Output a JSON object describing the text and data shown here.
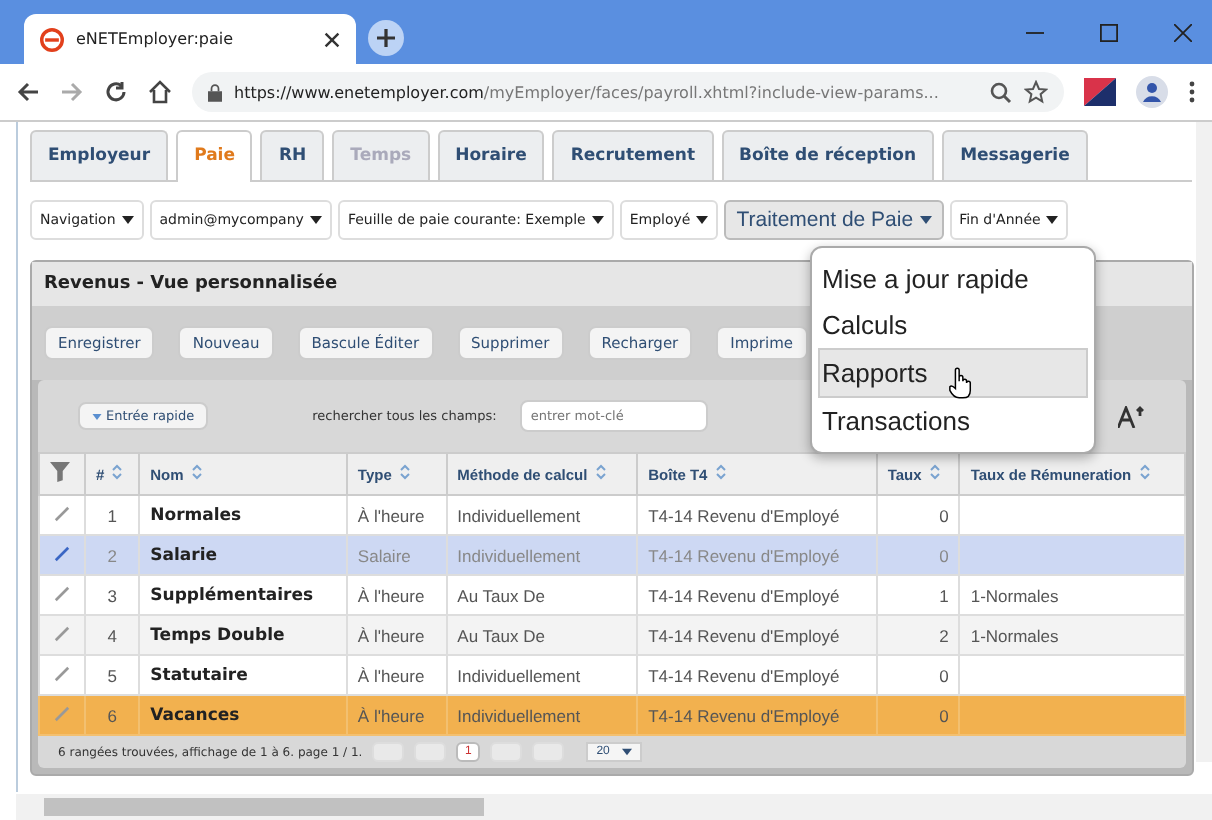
{
  "browser": {
    "tab_title": "eNETEmployer:paie",
    "url_host": "https://www.enetemployer.com",
    "url_path": "/myEmployer/faces/payroll.xhtml?include-view-params..."
  },
  "tabs": [
    {
      "label": "Employeur",
      "selected": false,
      "disabled": false
    },
    {
      "label": "Paie",
      "selected": true,
      "disabled": false
    },
    {
      "label": "RH",
      "selected": false,
      "disabled": false
    },
    {
      "label": "Temps",
      "selected": false,
      "disabled": true
    },
    {
      "label": "Horaire",
      "selected": false,
      "disabled": false
    },
    {
      "label": "Recrutement",
      "selected": false,
      "disabled": false
    },
    {
      "label": "Boîte de réception",
      "selected": false,
      "disabled": false
    },
    {
      "label": "Messagerie",
      "selected": false,
      "disabled": false
    }
  ],
  "nav": [
    {
      "label": "Navigation",
      "active": false
    },
    {
      "label": "admin@mycompany",
      "active": false
    },
    {
      "label": "Feuille de paie courante: Exemple",
      "active": false
    },
    {
      "label": "Employé",
      "active": false
    },
    {
      "label": "Traitement de Paie",
      "active": true
    },
    {
      "label": "Fin d'Année",
      "active": false
    }
  ],
  "menu": [
    {
      "label": "Mise a jour rapide",
      "selected": false
    },
    {
      "label": "Calculs",
      "selected": false
    },
    {
      "label": "Rapports",
      "selected": true
    },
    {
      "label": "Transactions",
      "selected": false
    }
  ],
  "panel": {
    "title": "Revenus - Vue personnalisée",
    "toolbar": [
      "Enregistrer",
      "Nouveau",
      "Bascule Éditer",
      "Supprimer",
      "Recharger",
      "Imprime"
    ],
    "quick_entry": "Entrée rapide",
    "search_label": "rechercher tous les champs:",
    "search_placeholder": "entrer mot-clé"
  },
  "table": {
    "columns": [
      "#",
      "Nom",
      "Type",
      "Méthode de calcul",
      "Boîte T4",
      "Taux",
      "Taux de Rémuneration"
    ],
    "rows": [
      {
        "num": "1",
        "name": "Normales",
        "type": "À l'heure",
        "method": "Individuellement",
        "box": "T4-14 Revenu d'Employé",
        "rate": "0",
        "pay_rate": "",
        "selected": false,
        "highlighted": false
      },
      {
        "num": "2",
        "name": "Salarie",
        "type": "Salaire",
        "method": "Individuellement",
        "box": "T4-14 Revenu d'Employé",
        "rate": "0",
        "pay_rate": "",
        "selected": true,
        "highlighted": false
      },
      {
        "num": "3",
        "name": "Supplémentaires",
        "type": "À l'heure",
        "method": "Au Taux De",
        "box": "T4-14 Revenu d'Employé",
        "rate": "1",
        "pay_rate": "1-Normales",
        "selected": false,
        "highlighted": false
      },
      {
        "num": "4",
        "name": "Temps Double",
        "type": "À l'heure",
        "method": "Au Taux De",
        "box": "T4-14 Revenu d'Employé",
        "rate": "2",
        "pay_rate": "1-Normales",
        "selected": false,
        "highlighted": false
      },
      {
        "num": "5",
        "name": "Statutaire",
        "type": "À l'heure",
        "method": "Individuellement",
        "box": "T4-14 Revenu d'Employé",
        "rate": "0",
        "pay_rate": "",
        "selected": false,
        "highlighted": false
      },
      {
        "num": "6",
        "name": "Vacances",
        "type": "À l'heure",
        "method": "Individuellement",
        "box": "T4-14 Revenu d'Employé",
        "rate": "0",
        "pay_rate": "",
        "selected": false,
        "highlighted": true
      }
    ],
    "footer": "6 rangées trouvées, affichage de 1 à 6. page 1 / 1.",
    "page": "1",
    "page_size": "20"
  }
}
